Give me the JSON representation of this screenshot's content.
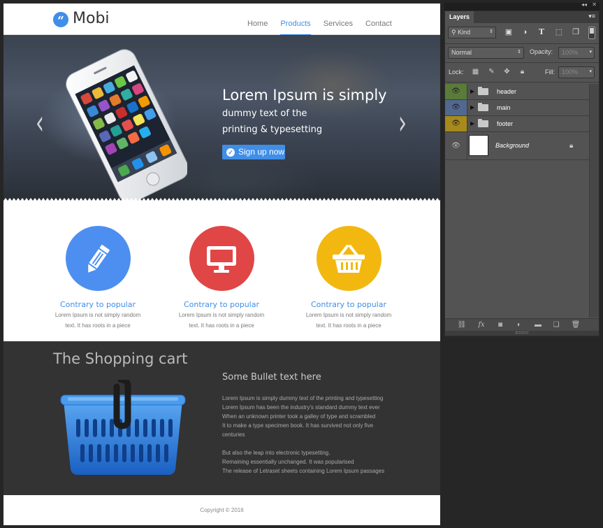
{
  "site": {
    "logo_glyph": "“",
    "logo_text": "Mobi",
    "nav": [
      {
        "label": "Home",
        "active": false
      },
      {
        "label": "Products",
        "active": true
      },
      {
        "label": "Services",
        "active": false
      },
      {
        "label": "Contact",
        "active": false
      }
    ],
    "accent_color": "#3f8ee8"
  },
  "hero": {
    "title": "Lorem Ipsum is simply",
    "line2": "dummy text of the",
    "line3": "printing & typesetting",
    "button_label": "Sign up now",
    "arrow_left": "‹",
    "arrow_right": "›"
  },
  "features": [
    {
      "icon": "pencil-icon",
      "color": "#4d8ff0",
      "title": "Contrary to popular",
      "desc1": "Lorem Ipsum is not simply random",
      "desc2": "text. It has roots in a piece"
    },
    {
      "icon": "monitor-icon",
      "color": "#e04646",
      "title": "Contrary to popular",
      "desc1": "Lorem Ipsum is not simply random",
      "desc2": "text. It has roots in a piece"
    },
    {
      "icon": "basket-icon",
      "color": "#f2b80f",
      "title": "Contrary to popular",
      "desc1": "Lorem Ipsum is not simply random",
      "desc2": "text. It has roots in a piece"
    }
  ],
  "cart": {
    "title": "The Shopping cart",
    "bullet_title": "Some Bullet text here",
    "lines": [
      "Lorem Ipsum is simply dummy text of the printing and typesetting",
      "Lorem Ipsum has been the industry's standard dummy text ever",
      "When an unknown printer took a galley of type and scrambled",
      "It to make a type specimen book. It has survived not only five",
      "centuries",
      "",
      "But also the leap into electronic typesetting,",
      "Remaining essentially unchanged. It was popularised",
      "The release of Letraset sheets containing Lorem Ipsum passages"
    ]
  },
  "footer": {
    "copyright": "Copyright © 2016"
  },
  "panel": {
    "tab_label": "Layers",
    "collapse_glyph": "◂◂",
    "close_glyph": "✕",
    "menu_glyph": "▾≡",
    "filter_kind": "Kind",
    "filter_icons": [
      "image-filter-icon",
      "adjustment-filter-icon",
      "type-filter-icon",
      "shape-filter-icon",
      "smart-object-filter-icon"
    ],
    "blend_mode": "Normal",
    "opacity_label": "Opacity:",
    "opacity_value": "100%",
    "lock_label": "Lock:",
    "fill_label": "Fill:",
    "fill_value": "100%",
    "layers": [
      {
        "name": "header",
        "type": "group",
        "eye_color": "#5a7b3a"
      },
      {
        "name": "main",
        "type": "group",
        "eye_color": "#51698e"
      },
      {
        "name": "footer",
        "type": "group",
        "eye_color": "#a68a1c"
      },
      {
        "name": "Background",
        "type": "background",
        "locked": true
      }
    ],
    "footer_icons": [
      "link-layers-icon",
      "fx-icon",
      "add-mask-icon",
      "adjustment-layer-icon",
      "new-group-icon",
      "new-layer-icon",
      "trash-icon"
    ]
  }
}
